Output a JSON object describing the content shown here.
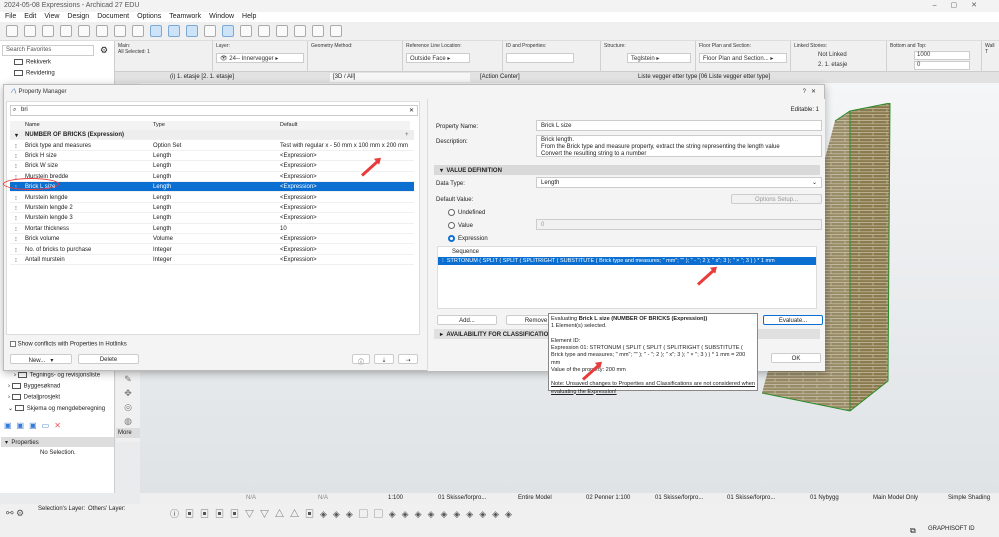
{
  "window": {
    "title": "2024-05-08 Expressions - Archicad 27 EDU"
  },
  "menu": [
    "File",
    "Edit",
    "View",
    "Design",
    "Document",
    "Options",
    "Teamwork",
    "Window",
    "Help"
  ],
  "infobox": {
    "main_label": "Main:",
    "all_selected": "All Selected: 1",
    "layer_label": "Layer:",
    "layer_value": "24-- Innervegger",
    "geometry_label": "Geometry Method:",
    "refline_label": "Reference Line Location:",
    "refline_value": "Outside Face",
    "id_label": "ID and Properties:",
    "structure_label": "Structure:",
    "structure_value": "Teglstein",
    "fps_label": "Floor Plan and Section:",
    "fps_value": "Floor Plan and Section...",
    "linked_label": "Linked Stories:",
    "linked_top": "Not Linked",
    "linked_bottom": "2. 1. etasje",
    "bt_label": "Bottom and Top:",
    "bt_top": "1000",
    "bt_bottom": "0",
    "wall_label": "Wall T"
  },
  "tabs": [
    "(i) 1. etasje [2. 1. etasje]",
    "[3D / All]",
    "[Action Center]",
    "Liste vegger etter type [06 Liste vegger etter type]"
  ],
  "sidebar": {
    "search_placeholder": "Search Favorites",
    "items_top": [
      "Rekkverk",
      "Revidering"
    ],
    "items_bottom": [
      "Tegnings- og revisjonsliste",
      "Byggesøknad",
      "Detaljprosjekt",
      "Skjema og mengdeberegning"
    ],
    "properties_header": "Properties",
    "no_selection": "No Selection.",
    "toolbox_more": "More"
  },
  "dialog": {
    "title": "Property Manager",
    "search_value": "bri",
    "columns": [
      "Name",
      "Type",
      "Default"
    ],
    "group": "NUMBER OF BRICKS (Expression)",
    "rows": [
      {
        "name": "Brick type and measures",
        "type": "Option Set",
        "default": "Test with regular x - 50 mm x 100 mm x 200 mm"
      },
      {
        "name": "Brick H size",
        "type": "Length",
        "default": "<Expression>"
      },
      {
        "name": "Brick W size",
        "type": "Length",
        "default": "<Expression>"
      },
      {
        "name": "Murstein bredde",
        "type": "Length",
        "default": "<Expression>"
      },
      {
        "name": "Brick L size",
        "type": "Length",
        "default": "<Expression>",
        "selected": true
      },
      {
        "name": "Murstein lengde",
        "type": "Length",
        "default": "<Expression>"
      },
      {
        "name": "Murstein lengde 2",
        "type": "Length",
        "default": "<Expression>"
      },
      {
        "name": "Murstein lengde 3",
        "type": "Length",
        "default": "<Expression>"
      },
      {
        "name": "Mortar thickness",
        "type": "Length",
        "default": "10"
      },
      {
        "name": "Brick volume",
        "type": "Volume",
        "default": "<Expression>"
      },
      {
        "name": "No. of bricks to purchase",
        "type": "Integer",
        "default": "<Expression>"
      },
      {
        "name": "Antall murstein",
        "type": "Integer",
        "default": "<Expression>"
      }
    ],
    "show_conflicts": "Show conflicts with Properties in Hotlinks",
    "new_label": "New...",
    "delete_label": "Delete",
    "editable": "Editable: 1",
    "property_name_label": "Property Name:",
    "property_name": "Brick L size",
    "description_label": "Description:",
    "description": [
      "Brick length.",
      "From the Brick type and measure property, extract the string representing the length value",
      "Convert the resulting string to a number"
    ],
    "value_definition": "VALUE DEFINITION",
    "data_type_label": "Data Type:",
    "data_type": "Length",
    "default_value_label": "Default Value:",
    "options_setup": "Options Setup...",
    "radio_undefined": "Undefined",
    "radio_value": "Value",
    "value_field": "0",
    "radio_expression": "Expression",
    "sequence_header": "Sequence",
    "expression": "STRTONUM ( SPLIT ( SPLIT ( SPLITRIGHT ( SUBSTITUTE ( Brick type and measures; \" mm\"; \"\" ); \" - \"; 2 ); \" x\"; 3 ); \" × \"; 3 ) ) * 1 mm",
    "add_label": "Add...",
    "remove_label": "Remove",
    "evaluate_label": "Evaluate...",
    "availability": "AVAILABILITY FOR CLASSIFICATIONS",
    "ok_label": "OK"
  },
  "popup": {
    "line1_prefix": "Evaluating ",
    "line1_bold": "Brick L size (NUMBER OF BRICKS (Expression))",
    "line2": "1 Element(s) selected.",
    "line3": "Element ID:",
    "line4": "Expression 01: STRTONUM ( SPLIT ( SPLIT ( SPLITRIGHT ( SUBSTITUTE ( Brick type and measures; \" mm\"; \"\" ); \" - \"; 2 ); \" x\"; 3 ); \" × \"; 3 ) ) * 1 mm = 200 mm",
    "line5": "Value of the property: 200 mm",
    "note": "Note: Unsaved changes to Properties and Classifications are not considered when evaluating the Expression!"
  },
  "bottom": {
    "na1": "N/A",
    "na2": "N/A",
    "scale": "1:100",
    "layer_combo": "01 Skisse/forpro...",
    "model": "Entire Model",
    "pens": "02 Penner 1:100",
    "override": "01 Skisse/forpro...",
    "dim": "01 Skisse/forpro...",
    "renovation": "01 Nybygg",
    "mvo": "Main Model Only",
    "shading": "Simple Shading",
    "selection_layer": "Selection's Layer:",
    "others_layer": "Others' Layer:",
    "brand": "GRAPHISOFT ID"
  },
  "colors": {
    "accent": "#0a6fd1",
    "arrow": "#e83b3b",
    "brick": "#8a7a4e"
  }
}
